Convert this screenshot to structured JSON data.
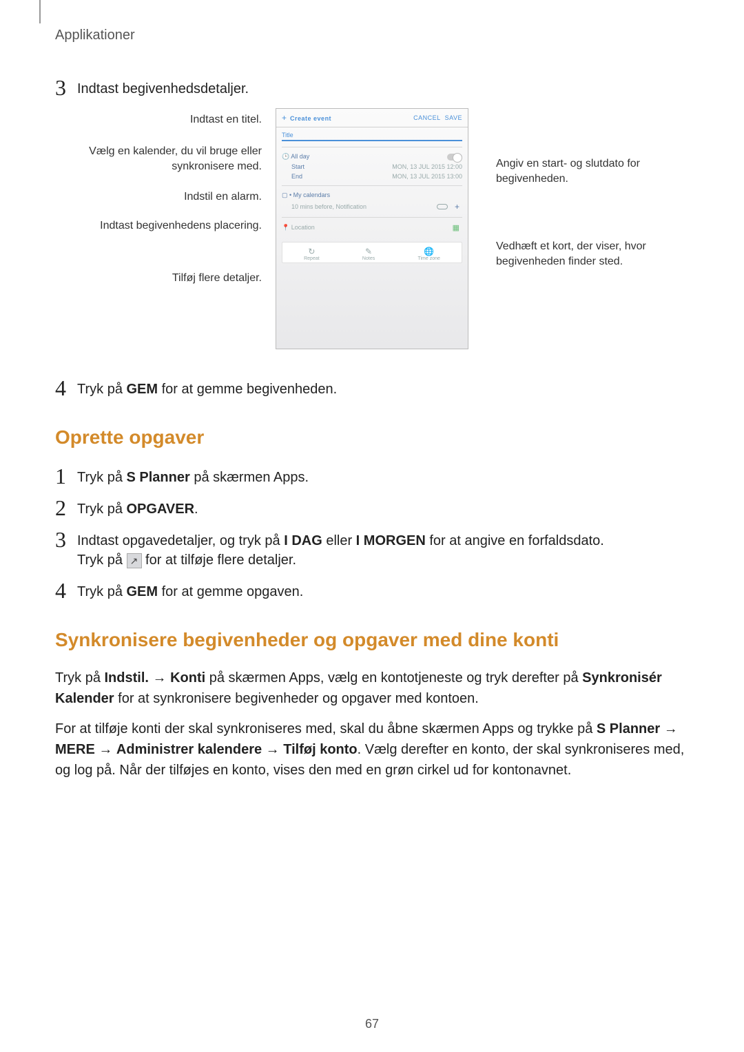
{
  "chapter": "Applikationer",
  "step3": {
    "num": "3",
    "text": "Indtast begivenhedsdetaljer."
  },
  "figure": {
    "callouts_left": {
      "title": "Indtast en titel.",
      "calendar": "Vælg en kalender, du vil bruge eller synkronisere med.",
      "alarm": "Indstil en alarm.",
      "location": "Indtast begivenhedens placering.",
      "more": "Tilføj flere detaljer."
    },
    "callouts_right": {
      "dates": "Angiv en start- og slutdato for begivenheden.",
      "map": "Vedhæft et kort, der viser, hvor begivenheden finder sted."
    },
    "mock": {
      "create_event": "Create event",
      "cancel": "CANCEL",
      "save": "SAVE",
      "title_placeholder": "Title",
      "all_day": "All day",
      "start": "Start",
      "end": "End",
      "date": "MON, 13 JUL 2015  12:00",
      "date2": "MON, 13 JUL 2015  13:00",
      "my_calendars": "My calendars",
      "reminder": "10 mins before, Notification",
      "location": "Location",
      "icn_repeat": "Repeat",
      "icn_notes": "Notes",
      "icn_tz": "Time zone"
    }
  },
  "step4": {
    "num": "4",
    "text_a": "Tryk på ",
    "bold": "GEM",
    "text_b": " for at gemme begivenheden."
  },
  "section2": {
    "heading": "Oprette opgaver",
    "s1": {
      "num": "1",
      "a": "Tryk på ",
      "b": "S Planner",
      "c": " på skærmen Apps."
    },
    "s2": {
      "num": "2",
      "a": "Tryk på ",
      "b": "OPGAVER",
      "c": "."
    },
    "s3": {
      "num": "3",
      "a": "Indtast opgavedetaljer, og tryk på ",
      "b": "I DAG",
      "c": " eller ",
      "d": "I MORGEN",
      "e": " for at angive en forfaldsdato.",
      "line2a": "Tryk på ",
      "line2b": " for at tilføje flere detaljer."
    },
    "s4": {
      "num": "4",
      "a": "Tryk på ",
      "b": "GEM",
      "c": " for at gemme opgaven."
    }
  },
  "section3": {
    "heading": "Synkronisere begivenheder og opgaver med dine konti",
    "p1": {
      "a": "Tryk på ",
      "b": "Indstil.",
      "arrow": " → ",
      "c": "Konti",
      "d": " på skærmen Apps, vælg en kontotjeneste og tryk derefter på ",
      "e": "Synkronisér Kalender",
      "f": " for at synkronisere begivenheder og opgaver med kontoen."
    },
    "p2": {
      "a": "For at tilføje konti der skal synkroniseres med, skal du åbne skærmen Apps og trykke på ",
      "b": "S Planner",
      "arrow": " → ",
      "c": "MERE",
      "d": "Administrer kalendere",
      "e": "Tilføj konto",
      "f": ". Vælg derefter en konto, der skal synkroniseres med, og log på. Når der tilføjes en konto, vises den med en grøn cirkel ud for kontonavnet."
    }
  },
  "page_number": "67"
}
